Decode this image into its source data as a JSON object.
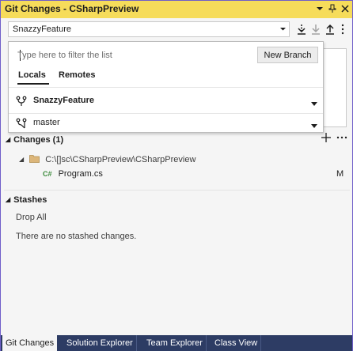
{
  "window": {
    "title": "Git Changes - CSharpPreview"
  },
  "toolbar": {
    "branch_selected": "SnazzyFeature"
  },
  "branch_picker": {
    "filter_placeholder": "Type here to filter the list",
    "new_branch_label": "New Branch",
    "tabs": [
      {
        "label": "Locals",
        "active": true
      },
      {
        "label": "Remotes",
        "active": false
      }
    ],
    "branches": [
      {
        "name": "SnazzyFeature",
        "current": true
      },
      {
        "name": "master",
        "current": false
      }
    ]
  },
  "changes": {
    "header": "Changes (1)",
    "path": "C:\\[]sc\\CSharpPreview\\CSharpPreview",
    "files": [
      {
        "name": "Program.cs",
        "status": "M"
      }
    ]
  },
  "stashes": {
    "header": "Stashes",
    "drop_all": "Drop All",
    "empty_message": "There are no stashed changes."
  },
  "bottom_tabs": [
    {
      "label": "Git Changes",
      "active": true
    },
    {
      "label": "Solution Explorer",
      "active": false
    },
    {
      "label": "Team Explorer",
      "active": false
    },
    {
      "label": "Class View",
      "active": false
    }
  ],
  "colors": {
    "title_bar": "#f6dc5a",
    "frame_border": "#6f5ec9",
    "tab_strip": "#2d3c64",
    "csharp_icon": "#3a8a3a",
    "folder_icon": "#dcb67a",
    "accent_arrow": "#1e73be"
  }
}
